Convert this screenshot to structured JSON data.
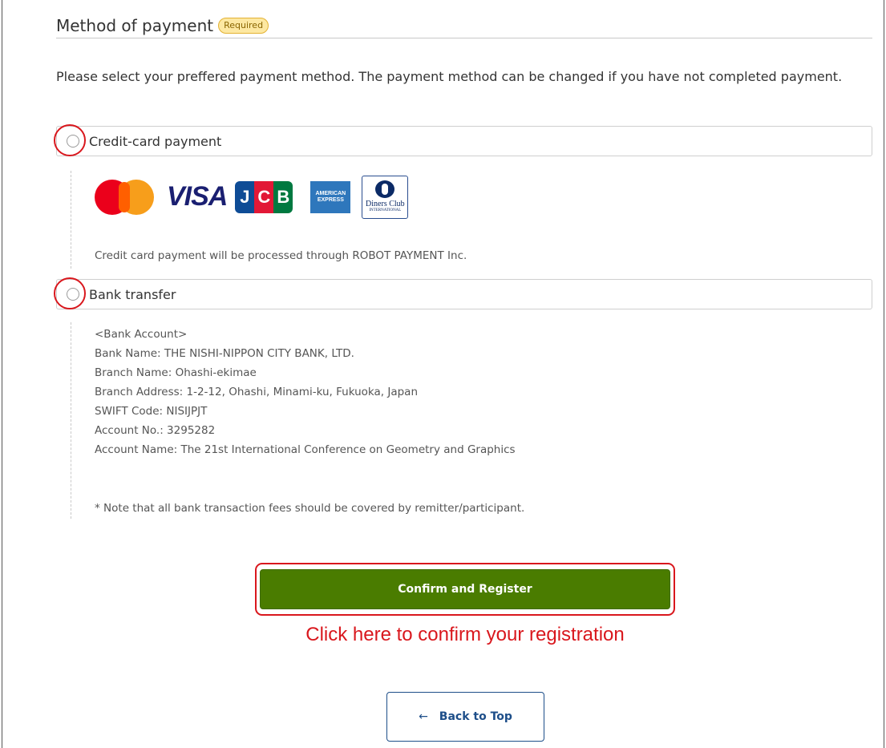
{
  "section": {
    "title": "Method of payment",
    "badge": "Required",
    "intro": "Please select your preffered payment method. The payment method can be changed if you have not completed payment."
  },
  "options": {
    "credit_card": {
      "label": "Credit-card payment",
      "note": "Credit card payment will be processed through ROBOT PAYMENT Inc.",
      "brands": {
        "visa": "VISA",
        "jcb": [
          "J",
          "C",
          "B"
        ],
        "amex": "AMERICAN EXPRESS",
        "diners_name": "Diners Club",
        "diners_intl": "INTERNATIONAL"
      }
    },
    "bank_transfer": {
      "label": "Bank transfer",
      "lines": [
        "<Bank Account>",
        "Bank Name: THE NISHI-NIPPON CITY BANK, LTD.",
        "Branch Name: Ohashi-ekimae",
        "Branch Address: 1-2-12, Ohashi, Minami-ku, Fukuoka, Japan",
        "SWIFT Code: NISIJPJT",
        "Account No.: 3295282",
        "Account Name: The 21st International Conference on Geometry and Graphics"
      ],
      "note": "* Note that all bank transaction fees should be covered by remitter/participant."
    }
  },
  "actions": {
    "confirm_label": "Confirm and Register",
    "confirm_hint": "Click here to confirm your registration",
    "back_label": "Back to Top",
    "back_arrow": "←"
  },
  "colors": {
    "confirm_bg": "#4a7c00",
    "highlight": "#d9171d",
    "back_text": "#1d4e89",
    "badge_bg": "#fde8a2"
  }
}
